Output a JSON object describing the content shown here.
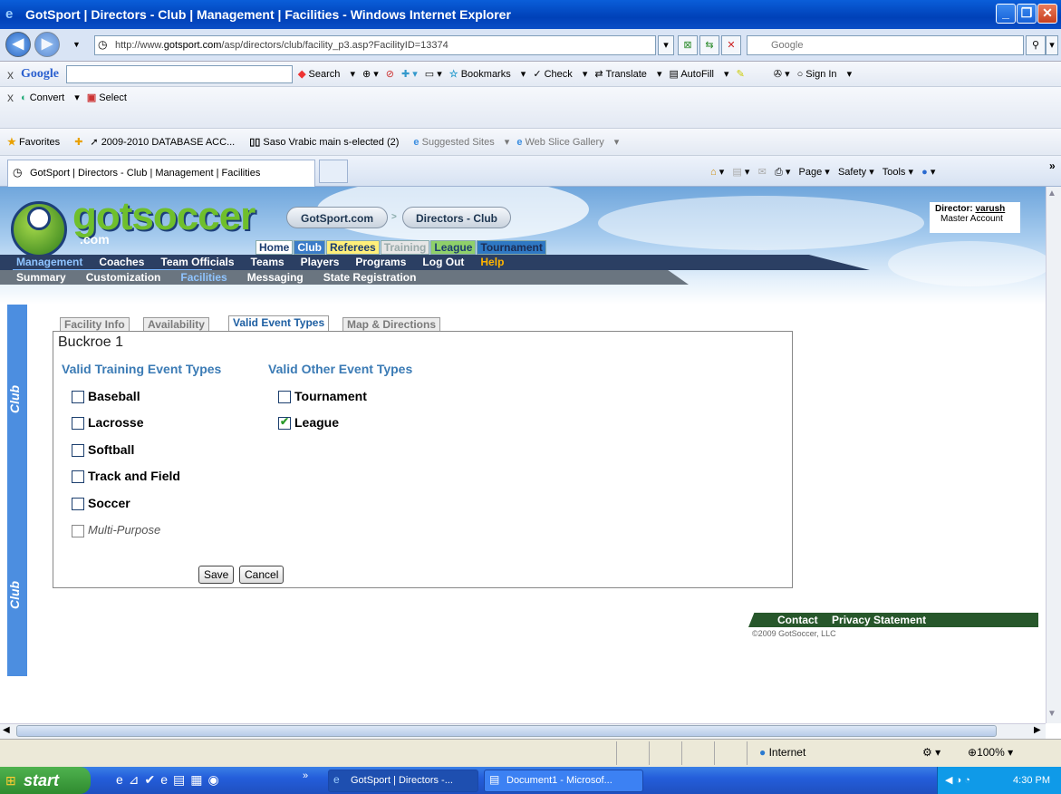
{
  "window": {
    "title": "GotSport | Directors - Club | Management | Facilities - Windows Internet Explorer"
  },
  "address": {
    "url_prefix": "http://www.",
    "url_domain": "gotsport.com",
    "url_path": "/asp/directors/club/facility_p3.asp?FacilityID=13374",
    "search_placeholder": "Google"
  },
  "google_toolbar": {
    "brand": "Google",
    "search": "Search",
    "bookmarks": "Bookmarks",
    "check": "Check",
    "translate": "Translate",
    "autofill": "AutoFill",
    "signin": "Sign In"
  },
  "convert_toolbar": {
    "convert": "Convert",
    "select": "Select"
  },
  "favorites": {
    "label": "Favorites",
    "items": [
      "2009-2010 DATABASE ACC...",
      "Saso Vrabic main s-elected (2)",
      "Suggested Sites",
      "Web Slice Gallery"
    ]
  },
  "tabs": {
    "active": "GotSport | Directors - Club | Management | Facilities"
  },
  "command_bar": {
    "page": "Page",
    "safety": "Safety",
    "tools": "Tools"
  },
  "site": {
    "logo": "gotsoccer",
    "logo_sub": ".com",
    "breadcrumb": [
      "GotSport.com",
      "Directors - Club"
    ],
    "top_menu": [
      "Home",
      "Club",
      "Referees",
      "Training",
      "League",
      "Tournament"
    ],
    "nav1": [
      "Management",
      "Coaches",
      "Team Officials",
      "Teams",
      "Players",
      "Programs",
      "Log Out",
      "Help"
    ],
    "nav2": [
      "Summary",
      "Customization",
      "Facilities",
      "Messaging",
      "State Registration"
    ],
    "director_label": "Director:",
    "director_name": "varush",
    "account": "Master Account",
    "sidebar_label": "Club"
  },
  "panel": {
    "tabs": [
      "Facility Info",
      "Availability",
      "Valid Event Types",
      "Map & Directions"
    ],
    "facility_name": "Buckroe 1",
    "training_heading": "Valid Training Event Types",
    "other_heading": "Valid Other Event Types",
    "training_items": [
      {
        "label": "Baseball",
        "checked": false
      },
      {
        "label": "Lacrosse",
        "checked": false
      },
      {
        "label": "Softball",
        "checked": false
      },
      {
        "label": "Track and Field",
        "checked": false
      },
      {
        "label": "Soccer",
        "checked": false
      },
      {
        "label": "Multi-Purpose",
        "checked": false
      }
    ],
    "other_items": [
      {
        "label": "Tournament",
        "checked": false
      },
      {
        "label": "League",
        "checked": true
      }
    ],
    "save": "Save",
    "cancel": "Cancel"
  },
  "footer": {
    "contact": "Contact",
    "privacy": "Privacy Statement",
    "copyright": "©2009 GotSoccer, LLC"
  },
  "status": {
    "zone": "Internet",
    "zoom": "100%"
  },
  "taskbar": {
    "start": "start",
    "tasks": [
      "GotSport | Directors -...",
      "Document1 - Microsof..."
    ],
    "clock": "4:30 PM"
  }
}
